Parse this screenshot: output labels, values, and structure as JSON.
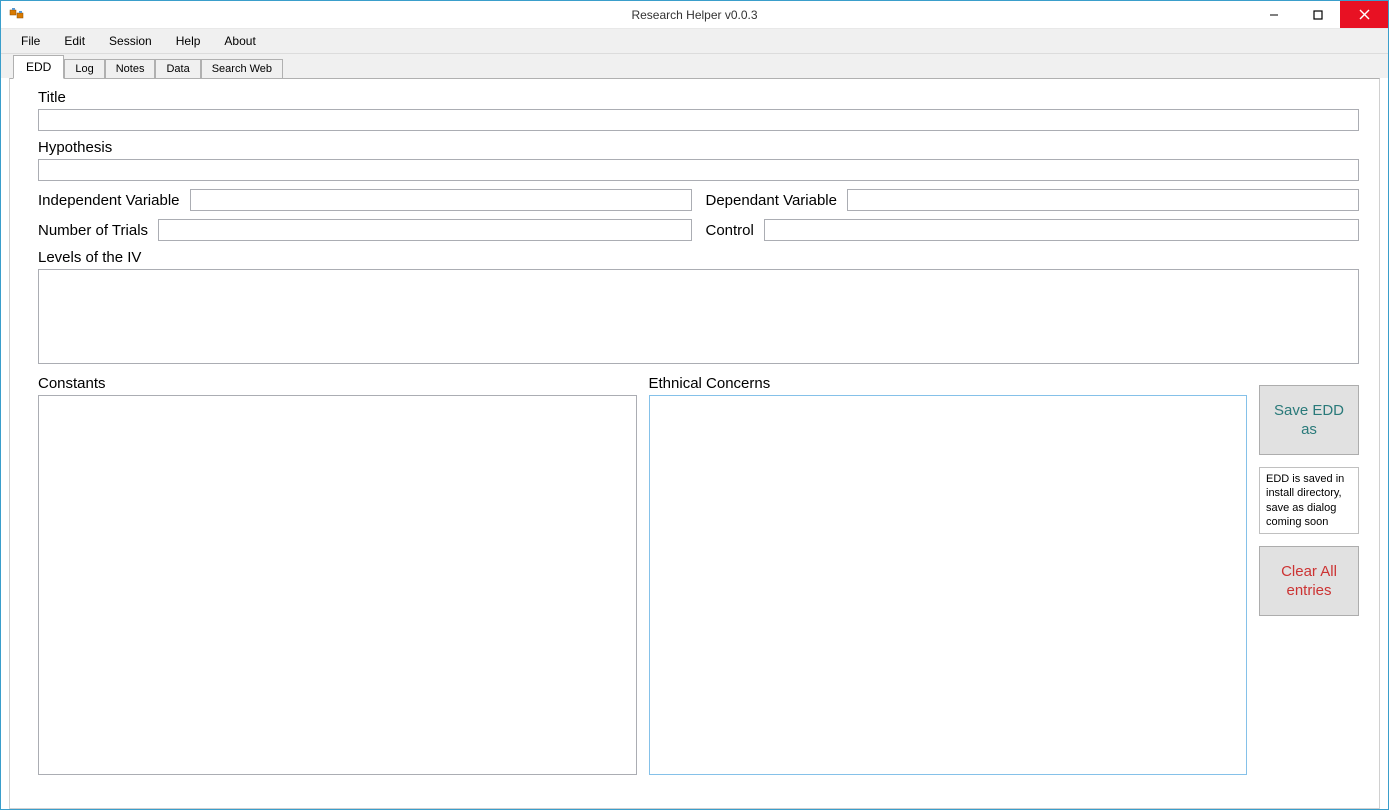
{
  "window": {
    "title": "Research Helper v0.0.3"
  },
  "menu": {
    "items": [
      "File",
      "Edit",
      "Session",
      "Help",
      "About"
    ]
  },
  "tabs": {
    "items": [
      "EDD",
      "Log",
      "Notes",
      "Data",
      "Search Web"
    ],
    "active": "EDD"
  },
  "form": {
    "title_label": "Title",
    "title_value": "",
    "hypothesis_label": "Hypothesis",
    "hypothesis_value": "",
    "iv_label": "Independent Variable",
    "iv_value": "",
    "dv_label": "Dependant Variable",
    "dv_value": "",
    "trials_label": "Number of Trials",
    "trials_value": "",
    "control_label": "Control",
    "control_value": "",
    "levels_label": "Levels of the IV",
    "levels_value": "",
    "constants_label": "Constants",
    "constants_value": "",
    "ethics_label": "Ethnical Concerns",
    "ethics_value": ""
  },
  "buttons": {
    "save": "Save EDD as",
    "hint": "EDD is saved in install directory, save as dialog coming soon",
    "clear": "Clear All entries"
  }
}
